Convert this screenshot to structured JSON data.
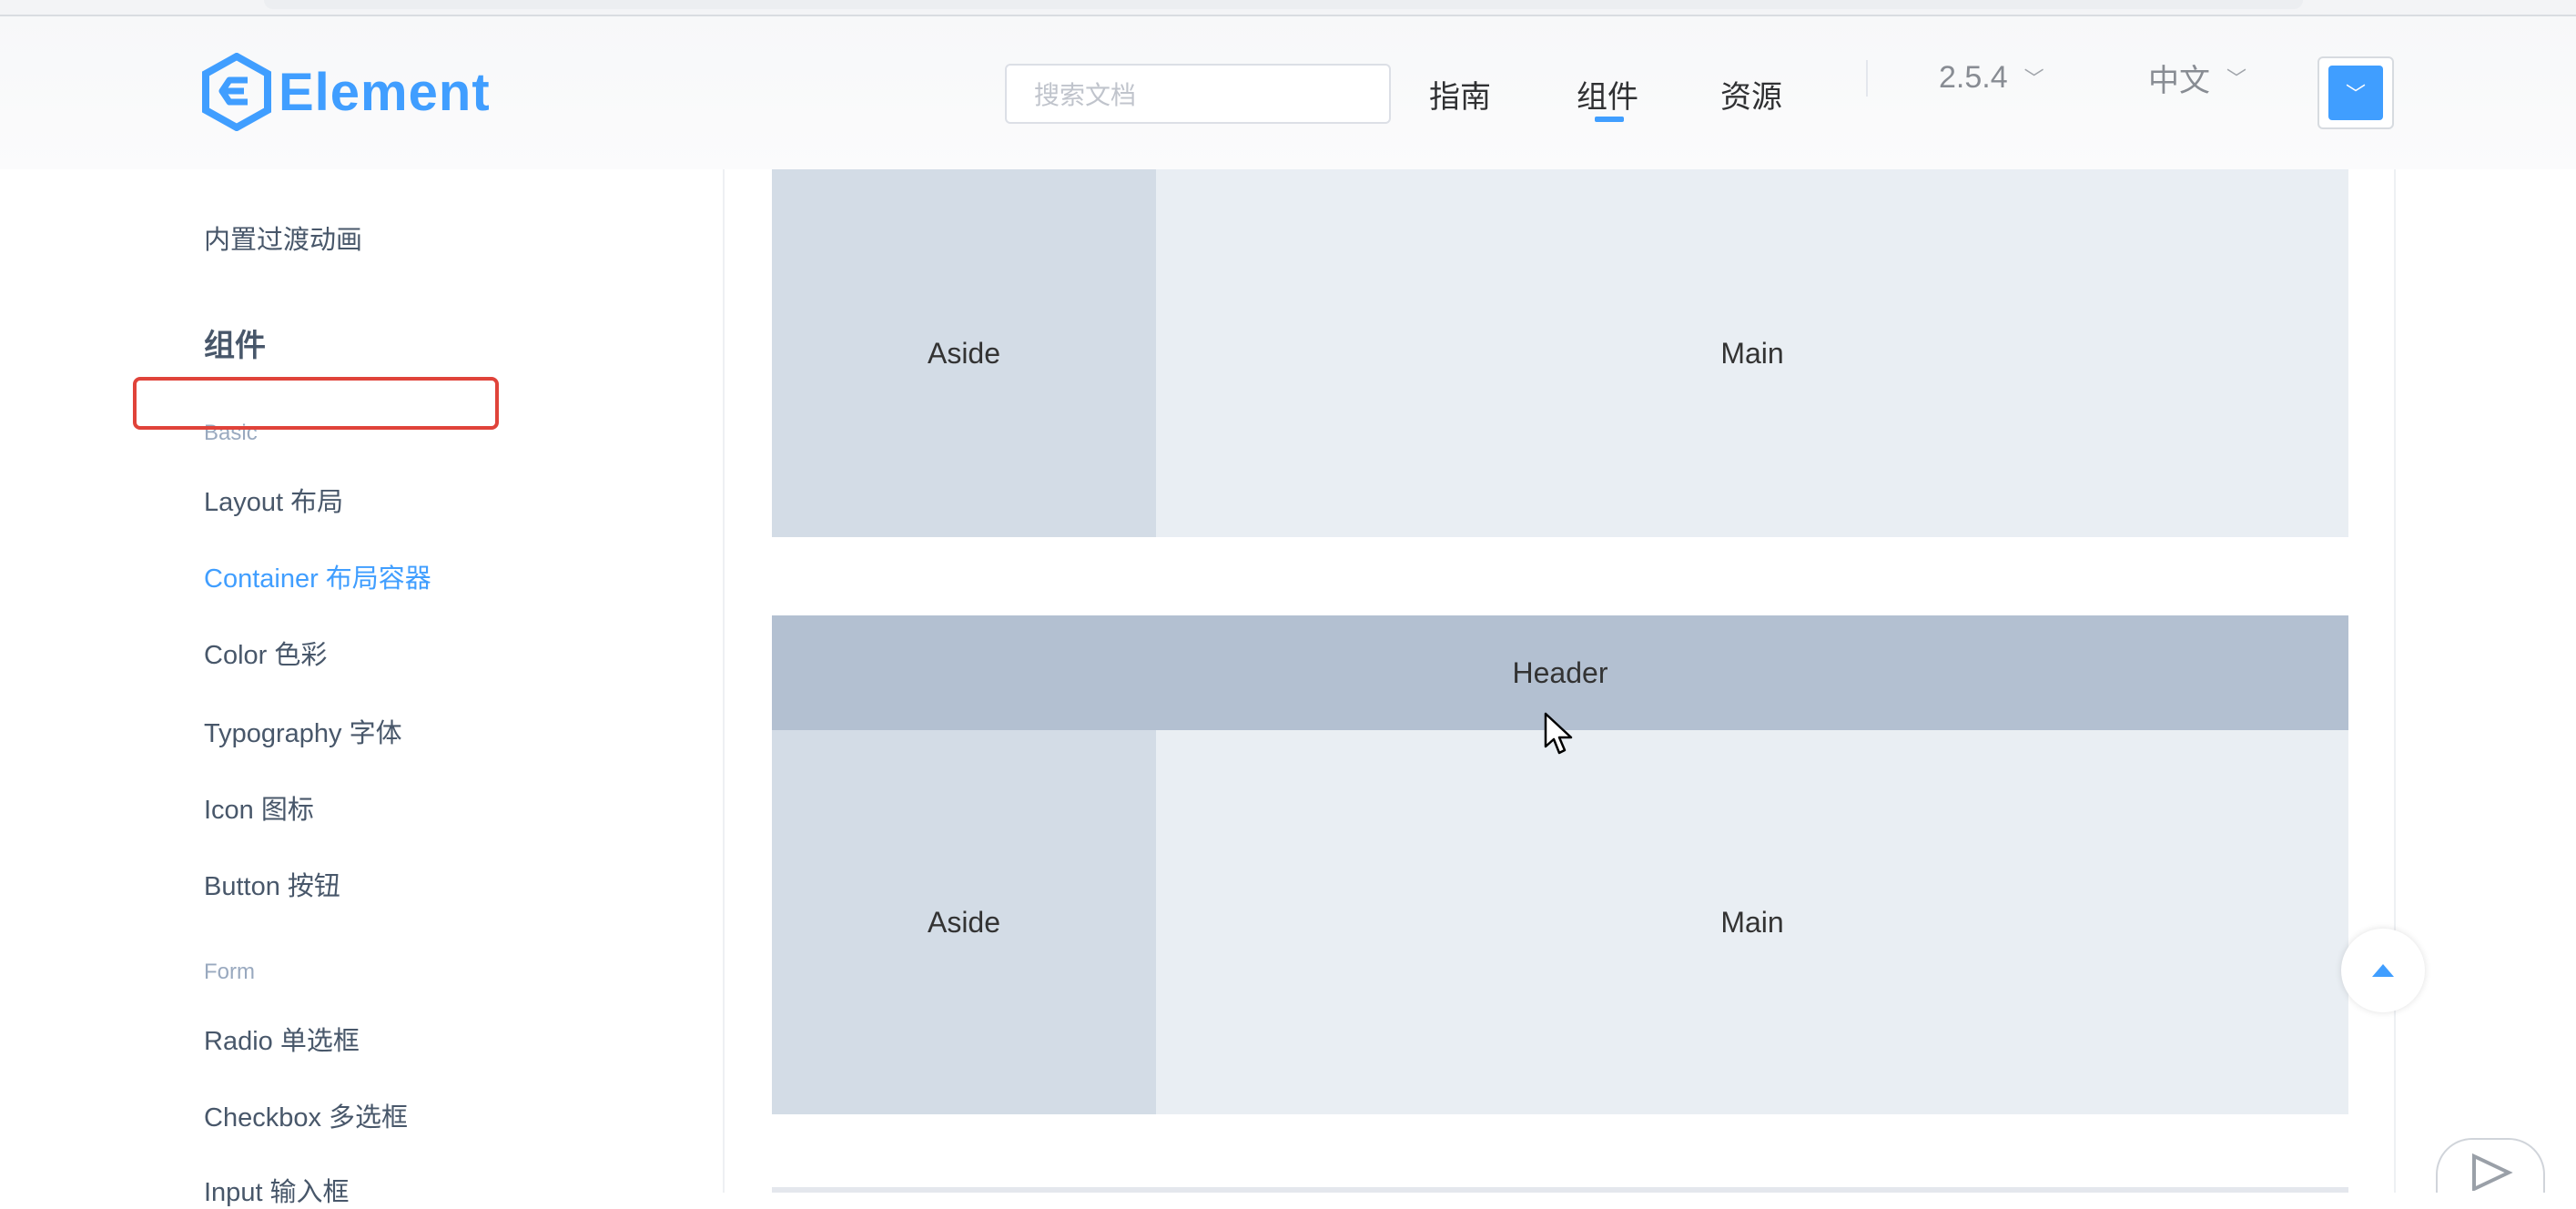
{
  "header": {
    "logo_text": "Element",
    "search_placeholder": "搜索文档",
    "nav": [
      "指南",
      "组件",
      "资源"
    ],
    "version": "2.5.4",
    "language": "中文"
  },
  "sidebar": {
    "top_item": "内置过渡动画",
    "heading": "组件",
    "group_basic": "Basic",
    "basic_items": [
      "Layout 布局",
      "Container 布局容器",
      "Color 色彩",
      "Typography 字体",
      "Icon 图标",
      "Button 按钮"
    ],
    "group_form": "Form",
    "form_items": [
      "Radio 单选框",
      "Checkbox 多选框",
      "Input 输入框"
    ],
    "active_item": "Container 布局容器"
  },
  "content": {
    "block1": {
      "aside": "Aside",
      "main": "Main"
    },
    "block2": {
      "header": "Header",
      "aside": "Aside",
      "main": "Main"
    }
  },
  "colors": {
    "accent": "#409eff",
    "aside": "#d3dce6",
    "main": "#e9eef3",
    "header": "#b3c0d1",
    "highlight": "#e0433a"
  },
  "icons": {
    "logo": "element-logo-icon",
    "chevron": "chevron-down-icon",
    "theme": "theme-dropdown-icon",
    "backtop": "caret-up-icon",
    "cursor": "mouse-pointer-icon",
    "widget": "play-icon"
  }
}
